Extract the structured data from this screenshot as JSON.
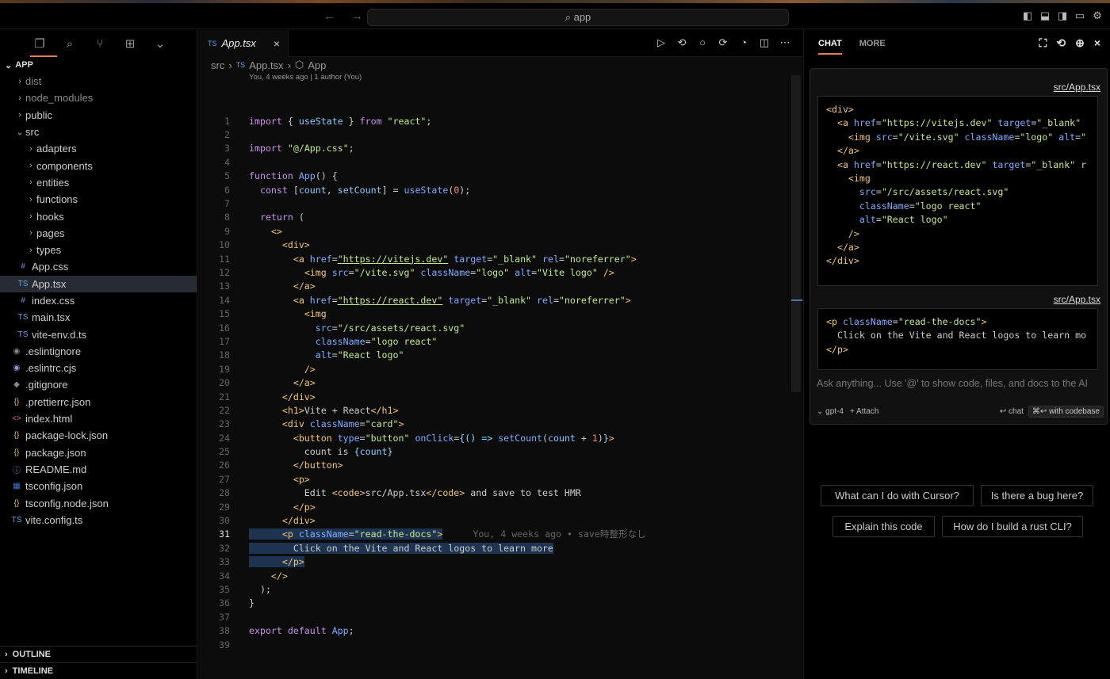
{
  "command_center": {
    "placeholder": "app"
  },
  "explorer": {
    "root": "APP",
    "items": [
      {
        "label": "dist",
        "kind": "folder",
        "depth": 1,
        "dim": true
      },
      {
        "label": "node_modules",
        "kind": "folder",
        "depth": 1,
        "dim": true
      },
      {
        "label": "public",
        "kind": "folder",
        "depth": 1
      },
      {
        "label": "src",
        "kind": "folder-open",
        "depth": 1
      },
      {
        "label": "adapters",
        "kind": "folder",
        "depth": 2
      },
      {
        "label": "components",
        "kind": "folder",
        "depth": 2
      },
      {
        "label": "entities",
        "kind": "folder",
        "depth": 2
      },
      {
        "label": "functions",
        "kind": "folder",
        "depth": 2
      },
      {
        "label": "hooks",
        "kind": "folder",
        "depth": 2
      },
      {
        "label": "pages",
        "kind": "folder",
        "depth": 2
      },
      {
        "label": "types",
        "kind": "folder",
        "depth": 2
      },
      {
        "label": "App.css",
        "kind": "css",
        "depth": 2
      },
      {
        "label": "App.tsx",
        "kind": "ts",
        "depth": 2,
        "selected": true
      },
      {
        "label": "index.css",
        "kind": "css",
        "depth": 2
      },
      {
        "label": "main.tsx",
        "kind": "ts",
        "depth": 2
      },
      {
        "label": "vite-env.d.ts",
        "kind": "ts",
        "depth": 2
      },
      {
        "label": ".eslintignore",
        "kind": "eslint",
        "depth": 1
      },
      {
        "label": ".eslintrc.cjs",
        "kind": "eslint2",
        "depth": 1
      },
      {
        "label": ".gitignore",
        "kind": "git",
        "depth": 1
      },
      {
        "label": ".prettierrc.json",
        "kind": "json",
        "depth": 1
      },
      {
        "label": "index.html",
        "kind": "html",
        "depth": 1
      },
      {
        "label": "package-lock.json",
        "kind": "json",
        "depth": 1
      },
      {
        "label": "package.json",
        "kind": "json",
        "depth": 1
      },
      {
        "label": "README.md",
        "kind": "info",
        "depth": 1
      },
      {
        "label": "tsconfig.json",
        "kind": "tsconfig",
        "depth": 1
      },
      {
        "label": "tsconfig.node.json",
        "kind": "json",
        "depth": 1
      },
      {
        "label": "vite.config.ts",
        "kind": "ts",
        "depth": 1
      }
    ],
    "outline_label": "OUTLINE",
    "timeline_label": "TIMELINE"
  },
  "editor": {
    "tab_label": "App.tsx",
    "tab_badge": "TS",
    "breadcrumb": [
      "src",
      "App.tsx",
      "App"
    ],
    "blame_header": "You, 4 weeks ago | 1 author (You)",
    "inline_blame": "You, 4 weeks ago • save時整形なし"
  },
  "chat": {
    "tab_chat": "CHAT",
    "tab_more": "MORE",
    "file1": "src/App.tsx",
    "file2": "src/App.tsx",
    "ask_placeholder": "Ask anything... Use '@' to show code, files, and docs to the AI",
    "model": "gpt-4",
    "attach": "+ Attach",
    "chat_btn": "↩ chat",
    "codebase_kbd": "⌘↩ with codebase",
    "suggestions": [
      "What can I do with Cursor?",
      "Is there a bug here?",
      "Explain this code",
      "How do I build a rust CLI?"
    ]
  }
}
